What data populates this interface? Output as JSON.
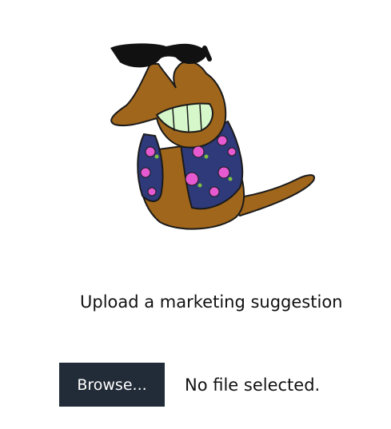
{
  "mascot": {
    "icon": "slug-with-sunglasses-icon",
    "colors": {
      "body": "#a0661c",
      "outline": "#1a1a1a",
      "shirt": "#2e3a7a",
      "flower": "#e55ad0",
      "leaf": "#7fbf3f",
      "teeth": "#d6f7c9",
      "sunglasses": "#111111"
    }
  },
  "upload": {
    "title": "Upload a marketing suggestion",
    "browse_label": "Browse...",
    "file_status": "No file selected."
  },
  "colors": {
    "button_bg": "#222b38",
    "button_text": "#ffffff",
    "text": "#111111",
    "background": "#ffffff"
  }
}
